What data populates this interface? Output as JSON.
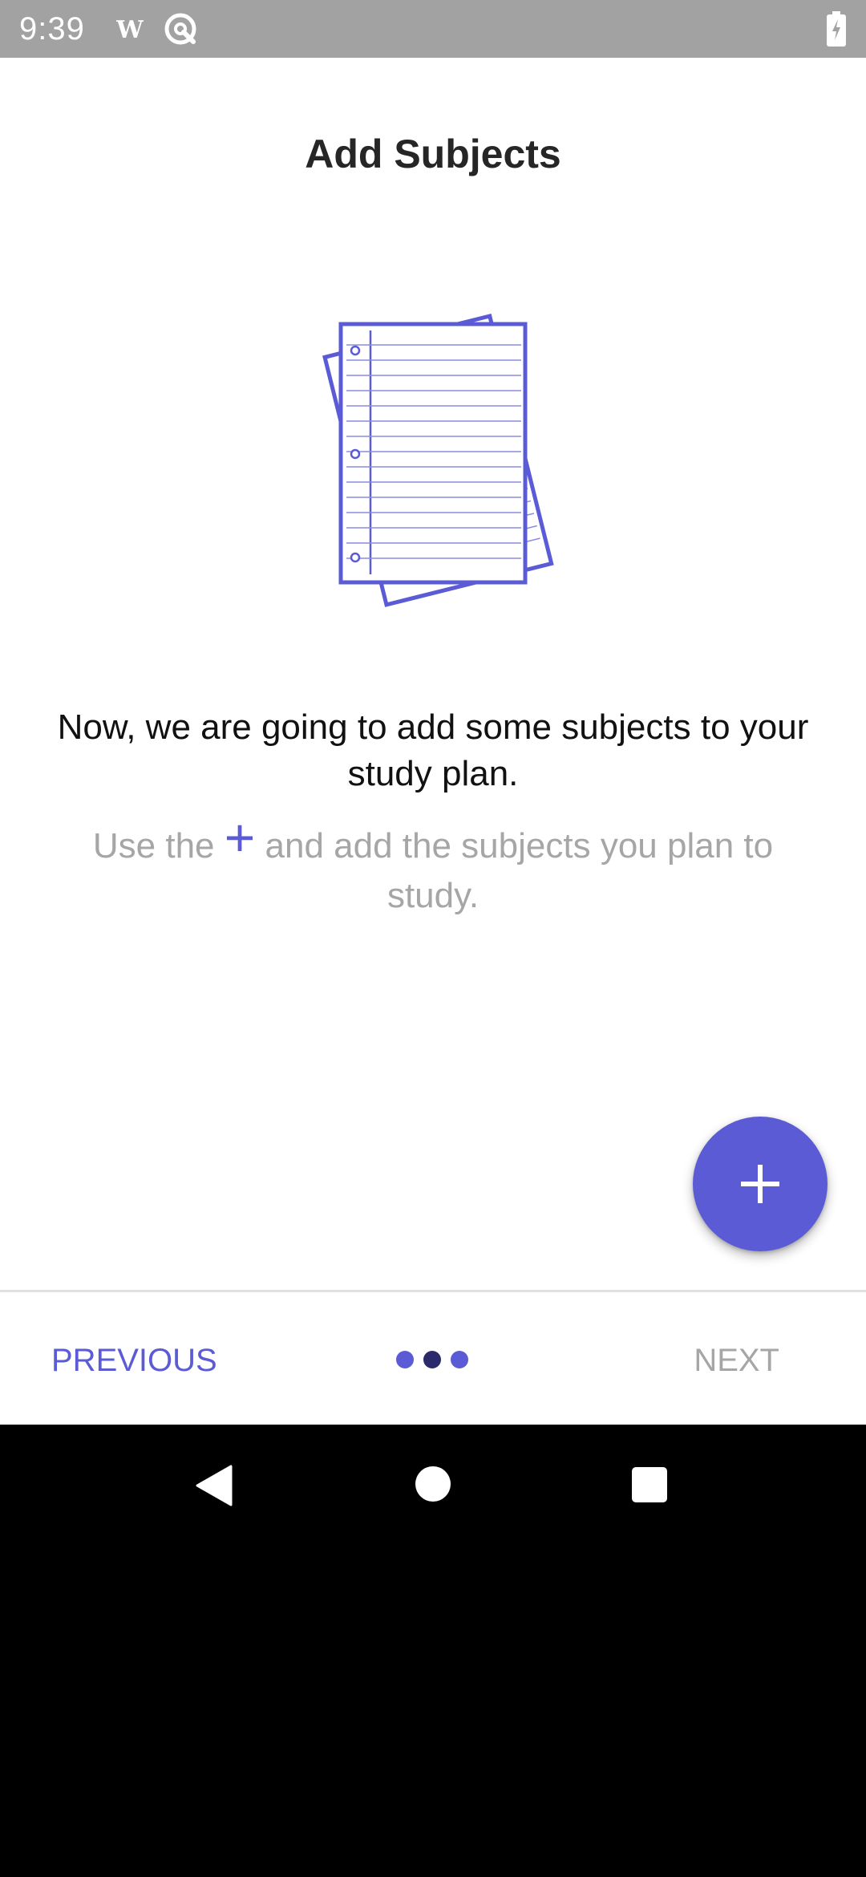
{
  "status_bar": {
    "time": "9:39",
    "icons": [
      "wikipedia-icon",
      "data-saver-icon",
      "battery-charging-icon"
    ]
  },
  "screen": {
    "title": "Add Subjects",
    "illustration": "notebook-pages-icon",
    "main_text": "Now, we are going to add some subjects to your study plan.",
    "hint_before": "Use the ",
    "hint_plus": "+",
    "hint_after": " and add the subjects you plan to study.",
    "fab_icon": "plus-icon"
  },
  "bottom_nav": {
    "previous_label": "PREVIOUS",
    "next_label": "NEXT",
    "pages": 3,
    "active_page": 2
  },
  "colors": {
    "accent": "#5b5bd5",
    "accent_dark": "#2b2a6b",
    "status_bar": "#a2a2a2",
    "hint_gray": "#a6a6a6"
  },
  "system_nav": {
    "icons": [
      "back-icon",
      "home-icon",
      "recents-icon"
    ]
  }
}
